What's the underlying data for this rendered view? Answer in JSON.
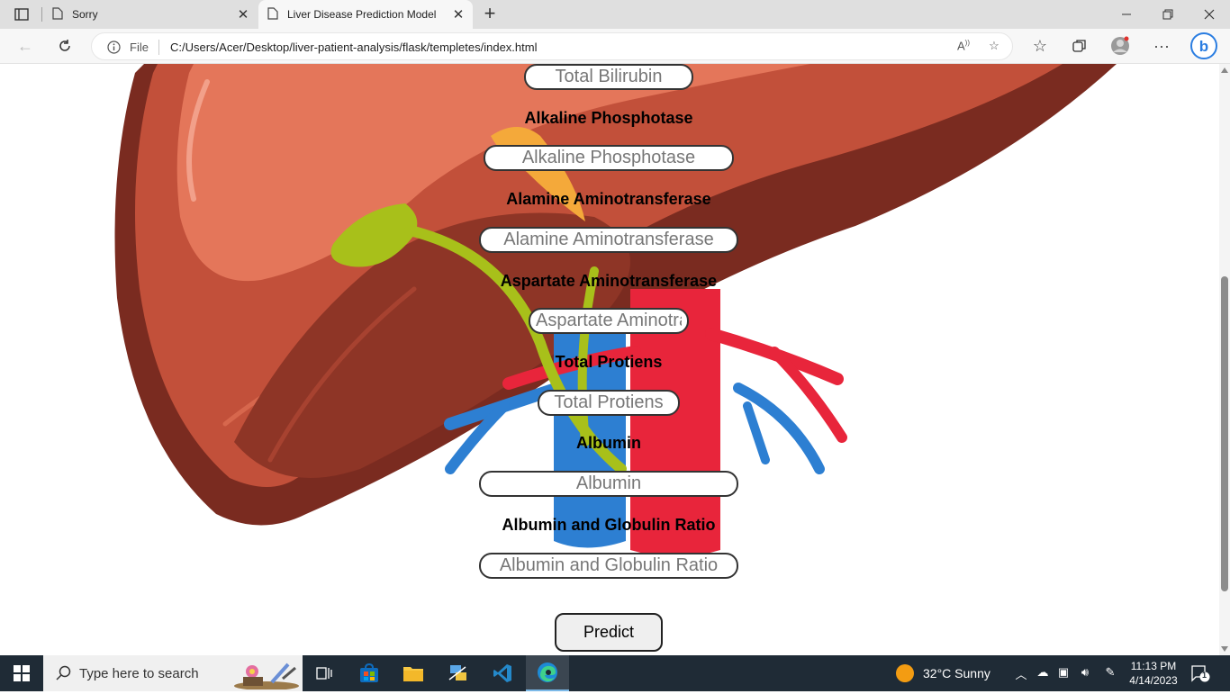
{
  "browser": {
    "tabs": [
      {
        "title": "Sorry"
      },
      {
        "title": "Liver Disease Prediction Model"
      }
    ],
    "address": {
      "scheme_label": "File",
      "url": "C:/Users/Acer/Desktop/liver-patient-analysis/flask/templetes/index.html"
    }
  },
  "form": {
    "fields": [
      {
        "placeholder": "Total Bilirubin"
      },
      {
        "label": "Alkaline Phosphotase",
        "placeholder": "Alkaline Phosphotase"
      },
      {
        "label": "Alamine Aminotransferase",
        "placeholder": "Alamine Aminotransferase"
      },
      {
        "label": "Aspartate Aminotransferase",
        "placeholder": "Aspartate Aminotransferase"
      },
      {
        "label": "Total Protiens",
        "placeholder": "Total Protiens"
      },
      {
        "label": "Albumin",
        "placeholder": "Albumin"
      },
      {
        "label": "Albumin and Globulin Ratio",
        "placeholder": "Albumin and Globulin Ratio"
      }
    ],
    "submit_label": "Predict"
  },
  "taskbar": {
    "search_placeholder": "Type here to search",
    "weather": "32°C  Sunny",
    "time": "11:13 PM",
    "date": "4/14/2023",
    "notification_count": "1"
  },
  "colors": {
    "liver_dark": "#7a2b20",
    "liver_mid": "#c2503a",
    "liver_light": "#e4765a",
    "artery_red": "#e8253b",
    "vein_blue": "#2d7fd2",
    "gallbladder_green": "#a8c01a",
    "taskbar_bg": "#1f2b36"
  }
}
